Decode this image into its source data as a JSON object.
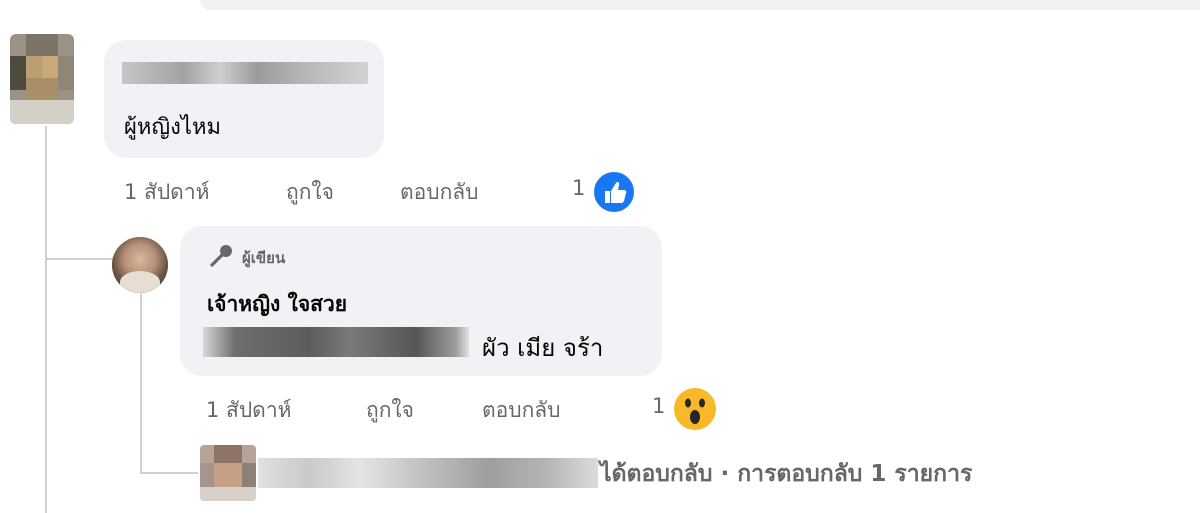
{
  "comment": {
    "text": "ผู้หญิงไหม",
    "time": "1 สัปดาห์",
    "like_label": "ถูกใจ",
    "reply_label": "ตอบกลับ",
    "reaction_count": "1",
    "reaction_icon": "like-icon",
    "reaction_color": "#1877f2"
  },
  "reply": {
    "badge": "ผู้เขียน",
    "badge_icon": "microphone-icon",
    "author": "เจ้าหญิง ใจสวย",
    "text": "ผัว เมีย จร้า",
    "time": "1 สัปดาห์",
    "like_label": "ถูกใจ",
    "reply_label": "ตอบกลับ",
    "reaction_count": "1",
    "reaction_icon": "wow-icon",
    "reaction_color": "#f7b928"
  },
  "reply_summary": {
    "text": "ได้ตอบกลับ · การตอบกลับ 1 รายการ"
  }
}
